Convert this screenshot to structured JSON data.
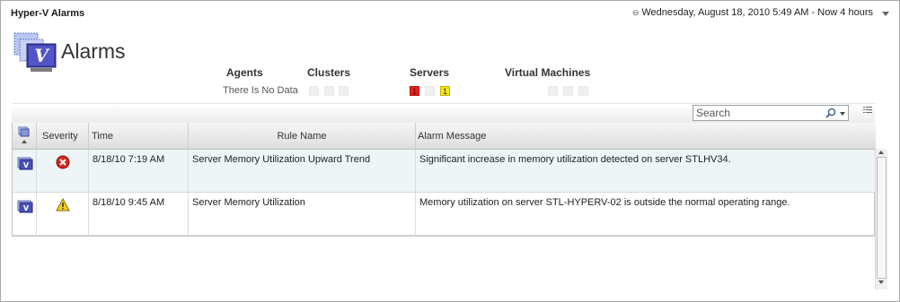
{
  "window": {
    "title": "Hyper-V Alarms"
  },
  "time_range": {
    "text": "Wednesday, August 18, 2010 5:49 AM - Now 4 hours"
  },
  "page": {
    "title": "Alarms"
  },
  "summary": {
    "headers": [
      "Agents",
      "Clusters",
      "Servers",
      "Virtual Machines"
    ],
    "agents_status": "There Is No Data",
    "servers": {
      "critical_count": "1",
      "warning_count": "1"
    }
  },
  "colors": {
    "critical": "#e8231f",
    "warning": "#f7e41c",
    "selected_row": "#eef5f7"
  },
  "search": {
    "placeholder": "Search"
  },
  "table": {
    "columns": [
      "Severity",
      "Time",
      "Rule Name",
      "Alarm Message"
    ],
    "rows": [
      {
        "severity_icon": "critical-error-icon",
        "time": "8/18/10 7:19 AM",
        "rule": "Server Memory Utilization Upward Trend",
        "message": "Significant increase in memory utilization detected on server STLHV34."
      },
      {
        "severity_icon": "warning-icon",
        "time": "8/18/10 9:45 AM",
        "rule": "Server Memory Utilization",
        "message": "Memory utilization on server STL-HYPERV-02 is outside the normal operating range."
      }
    ]
  }
}
